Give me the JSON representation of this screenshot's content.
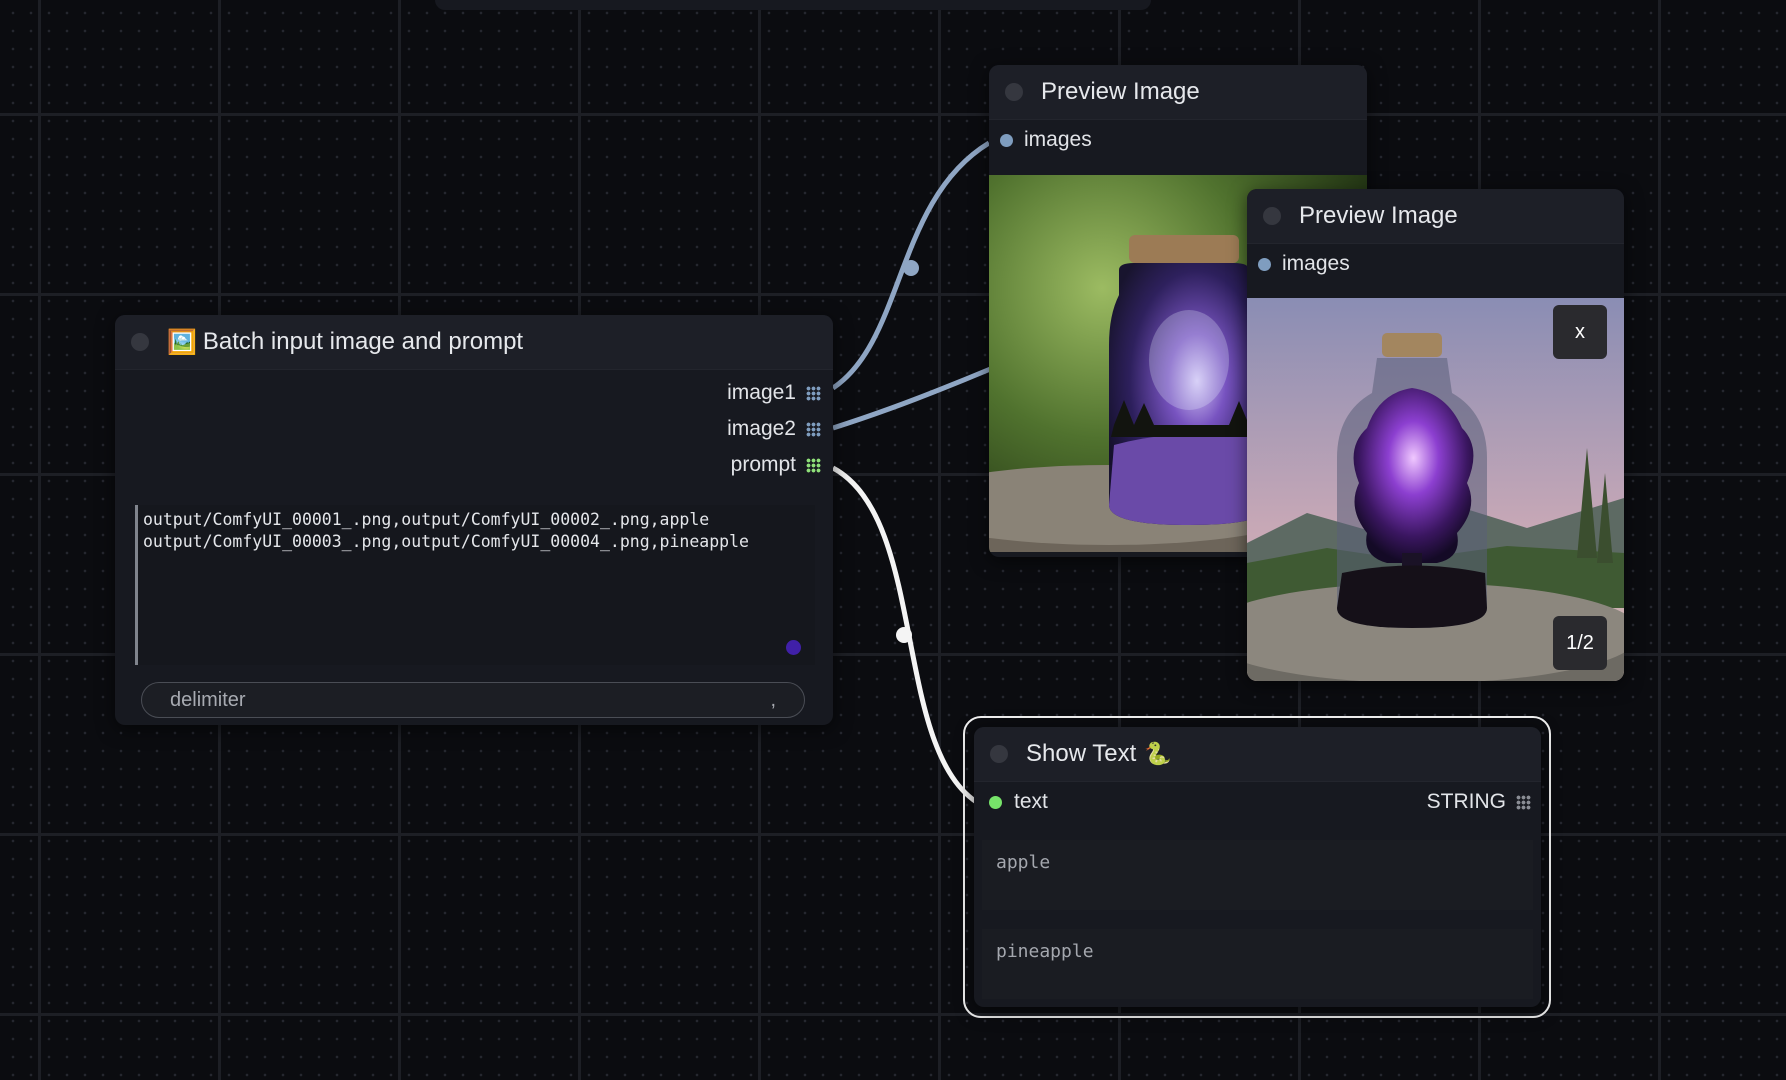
{
  "batch_node": {
    "emoji": "🖼️",
    "title": "Batch input image and prompt",
    "outputs": [
      "image1",
      "image2",
      "prompt"
    ],
    "prompt_lines": [
      "output/ComfyUI_00001_.png,output/ComfyUI_00002_.png,apple",
      "output/ComfyUI_00003_.png,output/ComfyUI_00004_.png,pineapple"
    ],
    "delimiter_label": "delimiter",
    "delimiter_value": ","
  },
  "preview_node_1": {
    "title": "Preview Image",
    "input_label": "images"
  },
  "preview_node_2": {
    "title": "Preview Image",
    "input_label": "images",
    "close_label": "x",
    "counter": "1/2"
  },
  "show_text_node": {
    "title": "Show Text",
    "emoji": "🐍",
    "input_label": "text",
    "output_label": "STRING",
    "outputs": [
      "apple",
      "pineapple"
    ]
  },
  "colors": {
    "image_slot": "#7f9dbf",
    "prompt_slot": "#8fe079",
    "text_input_dot": "#77e36a",
    "image_wire": "#8fa6c4",
    "text_wire": "#f4f4f4",
    "accent_purple": "#4020a8"
  }
}
